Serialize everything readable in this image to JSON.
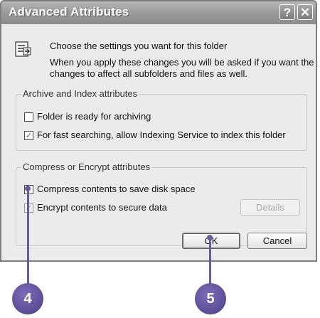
{
  "dialog": {
    "title": "Advanced Attributes",
    "help_glyph": "?",
    "close_glyph": "✕",
    "icon": "folder-settings-icon",
    "description_1": "Choose the settings you want for this folder",
    "description_2": "When you apply these changes you will be asked if you want the",
    "description_3": "changes to affect all subfolders and files as well."
  },
  "archive_group": {
    "legend": "Archive and Index attributes",
    "options": [
      {
        "label": "Folder is ready for archiving",
        "checked": false
      },
      {
        "label": "For fast searching, allow Indexing Service to index this folder",
        "checked": true
      }
    ]
  },
  "compress_group": {
    "legend": "Compress or Encrypt attributes",
    "options": [
      {
        "label": "Compress contents to save disk space",
        "checked": false
      },
      {
        "label": "Encrypt contents to secure data",
        "checked": true,
        "disabled": true
      }
    ],
    "details_label": "Details"
  },
  "buttons": {
    "ok": "OK",
    "cancel": "Cancel"
  },
  "callouts": [
    {
      "number": "4"
    },
    {
      "number": "5"
    }
  ],
  "colors": {
    "callout": "#5b4a98",
    "title_bar": "#9a9a9a"
  }
}
